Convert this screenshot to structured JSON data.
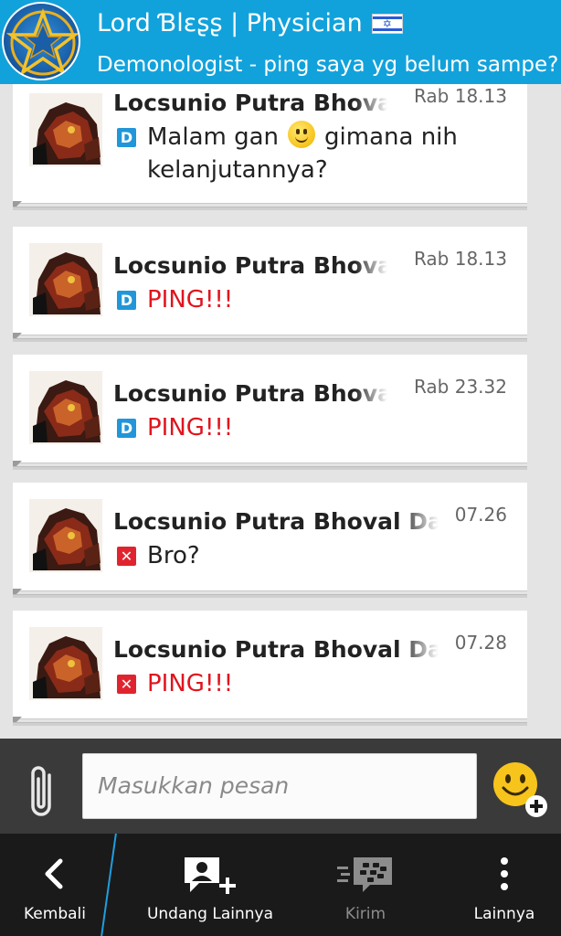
{
  "header": {
    "title": "Lord Ɓlɛʂʂ | Physician",
    "subtitle": "Demonologist - ping saya yg belum sampe?"
  },
  "colors": {
    "header_bg": "#12a2db",
    "delivered_badge": "#2196d9",
    "failed_badge": "#e0242f",
    "ping_text": "#e0141e",
    "accent_divider": "#1e9fe0"
  },
  "messages": [
    {
      "sender": "Locsunio Putra Bhoval",
      "time": "Rab 18.13",
      "status": "D",
      "status_type": "delivered",
      "text_before": "Malam gan",
      "text_after": "gimana nih kelanjutannya?",
      "has_emoji": true
    },
    {
      "sender": "Locsunio Putra Bhoval",
      "time": "Rab 18.13",
      "status": "D",
      "status_type": "delivered",
      "text": "PING!!!"
    },
    {
      "sender": "Locsunio Putra Bhoval",
      "time": "Rab 23.32",
      "status": "D",
      "status_type": "delivered",
      "text": "PING!!!"
    },
    {
      "sender": "Locsunio Putra Bhoval Dae",
      "time": "07.26",
      "status": "✕",
      "status_type": "failed",
      "text": "Bro?"
    },
    {
      "sender": "Locsunio Putra Bhoval Dae",
      "time": "07.28",
      "status": "✕",
      "status_type": "failed",
      "text": "PING!!!"
    }
  ],
  "composer": {
    "placeholder": "Masukkan pesan",
    "attach_icon": "paperclip-icon",
    "emoji_icon": "emoji-add-icon"
  },
  "actionbar": {
    "back_label": "Kembali",
    "invite_label": "Undang Lainnya",
    "send_label": "Kirim",
    "more_label": "Lainnya"
  }
}
